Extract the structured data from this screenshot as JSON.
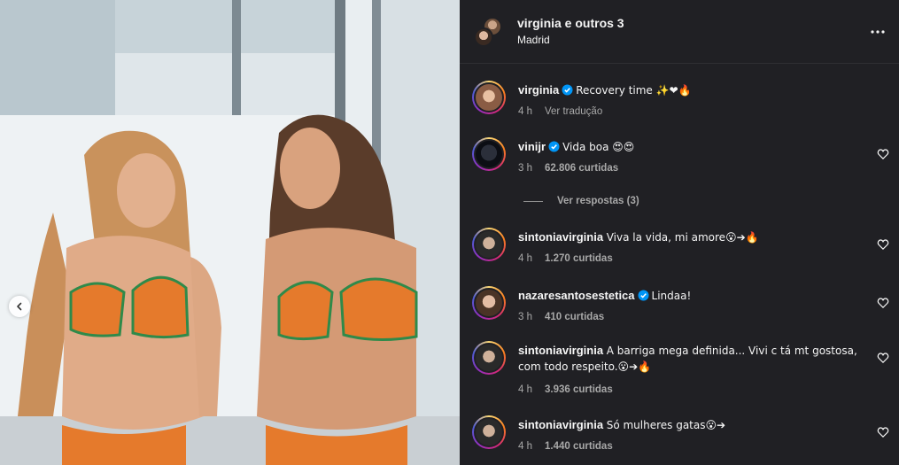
{
  "header": {
    "title": "virginia e outros 3",
    "location": "Madrid"
  },
  "comments": [
    {
      "user": "virginia",
      "verified": true,
      "text": "Recovery time ✨❤🔥",
      "time": "4 h",
      "action": "Ver tradução",
      "likes": null
    },
    {
      "user": "vinijr",
      "verified": true,
      "text": "Vida boa 😍😍",
      "time": "3 h",
      "action": null,
      "likes": "62.806 curtidas"
    },
    {
      "user": "sintoniavirginia",
      "verified": false,
      "text": "Viva la vida, mi amore😮➔🔥",
      "time": "4 h",
      "action": null,
      "likes": "1.270 curtidas"
    },
    {
      "user": "nazaresantosestetica",
      "verified": true,
      "text": "Lindaa!",
      "time": "3 h",
      "action": null,
      "likes": "410 curtidas"
    },
    {
      "user": "sintoniavirginia",
      "verified": false,
      "text": "A barriga mega definida... Vivi c tá mt gostosa, com todo respeito.😮➔🔥",
      "time": "4 h",
      "action": null,
      "likes": "3.936 curtidas"
    },
    {
      "user": "sintoniavirginia",
      "verified": false,
      "text": "Só mulheres gatas😮➔",
      "time": "4 h",
      "action": null,
      "likes": "1.440 curtidas"
    }
  ],
  "replies_label": "Ver respostas (3)",
  "colors": {
    "panel_bg": "#202024",
    "text": "#f5f5f5",
    "muted": "#a8a8a8",
    "verified": "#0095f6"
  },
  "icons": [
    "chevron-left-icon",
    "more-options-icon",
    "verified-badge-icon",
    "heart-icon"
  ]
}
